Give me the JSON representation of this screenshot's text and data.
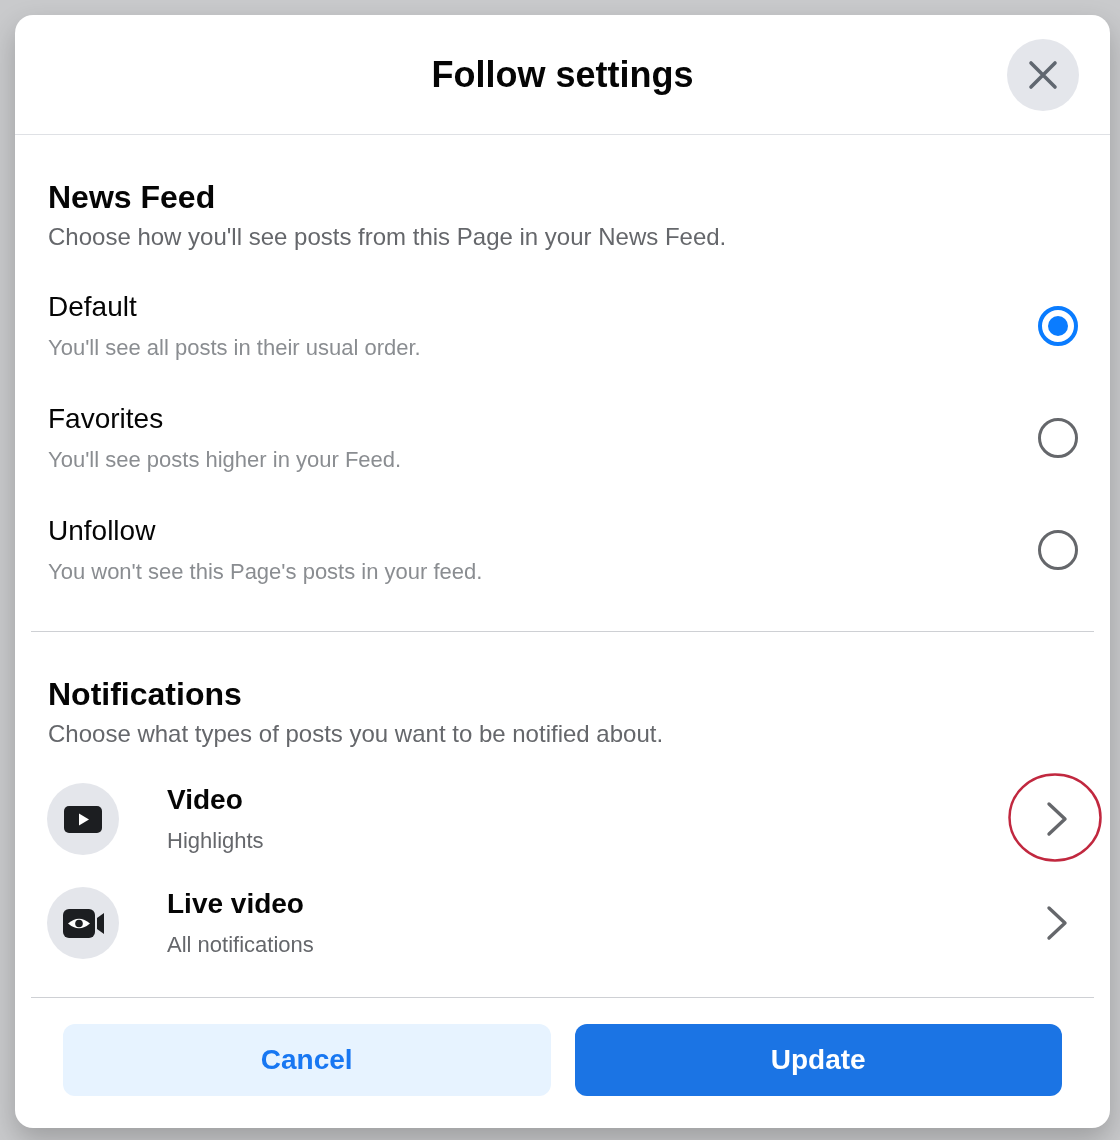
{
  "dialog": {
    "title": "Follow settings"
  },
  "news_feed": {
    "heading": "News Feed",
    "description": "Choose how you'll see posts from this Page in your News Feed.",
    "options": [
      {
        "label": "Default",
        "description": "You'll see all posts in their usual order.",
        "selected": true
      },
      {
        "label": "Favorites",
        "description": "You'll see posts higher in your Feed.",
        "selected": false
      },
      {
        "label": "Unfollow",
        "description": "You won't see this Page's posts in your feed.",
        "selected": false
      }
    ]
  },
  "notifications": {
    "heading": "Notifications",
    "description": "Choose what types of posts you want to be notified about.",
    "items": [
      {
        "kind": "video",
        "title": "Video",
        "value": "Highlights",
        "highlighted": true
      },
      {
        "kind": "live_video",
        "title": "Live video",
        "value": "All notifications",
        "highlighted": false
      }
    ]
  },
  "buttons": [
    {
      "kind": "secondary",
      "label": "Cancel"
    },
    {
      "kind": "primary",
      "label": "Update"
    }
  ]
}
